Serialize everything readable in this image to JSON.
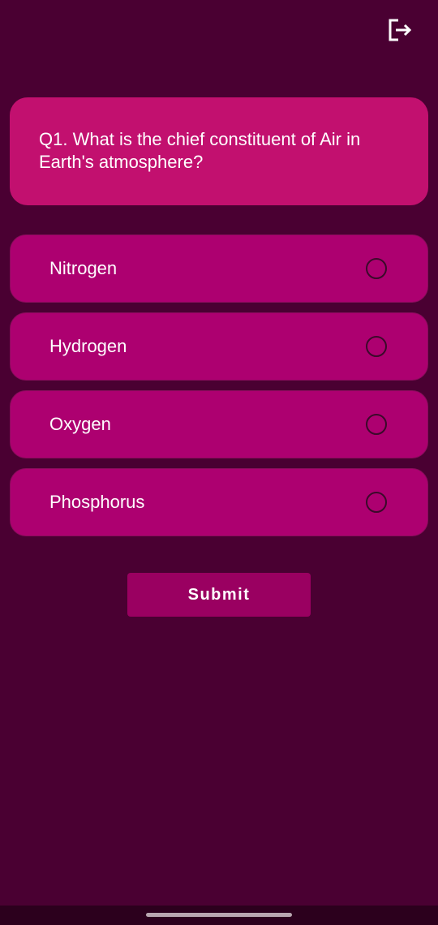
{
  "header": {
    "logout_icon": "logout-icon"
  },
  "question": {
    "text": "Q1. What is the chief constituent of Air in Earth's atmosphere?"
  },
  "options": [
    {
      "label": "Nitrogen"
    },
    {
      "label": "Hydrogen"
    },
    {
      "label": "Oxygen"
    },
    {
      "label": "Phosphorus"
    }
  ],
  "submit": {
    "label": "Submit"
  },
  "colors": {
    "background": "#4a0032",
    "question_card": "#c2106f",
    "option_card": "#ad0070",
    "submit_button": "#9a0061"
  }
}
